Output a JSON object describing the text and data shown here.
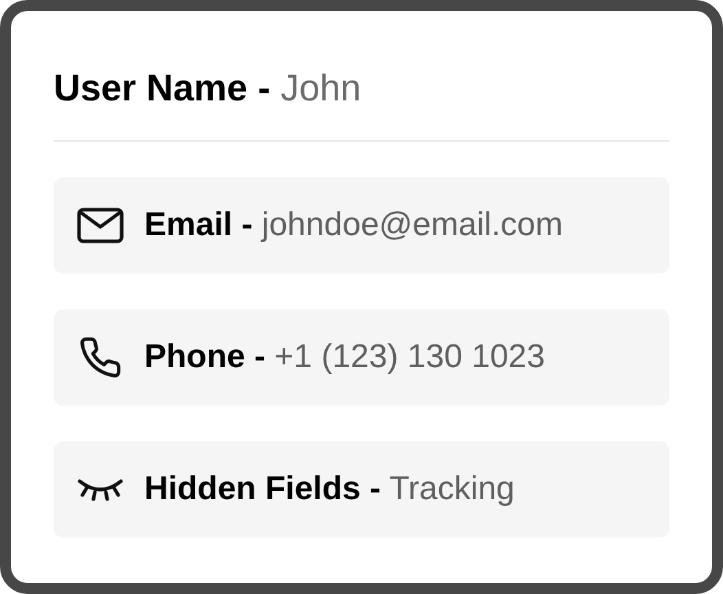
{
  "card": {
    "title": "**User Name -** John",
    "fields": [
      {
        "kind": "email",
        "text": "**Email -** johndoe@email.com"
      },
      {
        "kind": "phone",
        "text": "**Phone -** +1 (123) 130 1023"
      },
      {
        "kind": "hidden",
        "text": "**Hidden Fields -** Tracking"
      }
    ]
  }
}
